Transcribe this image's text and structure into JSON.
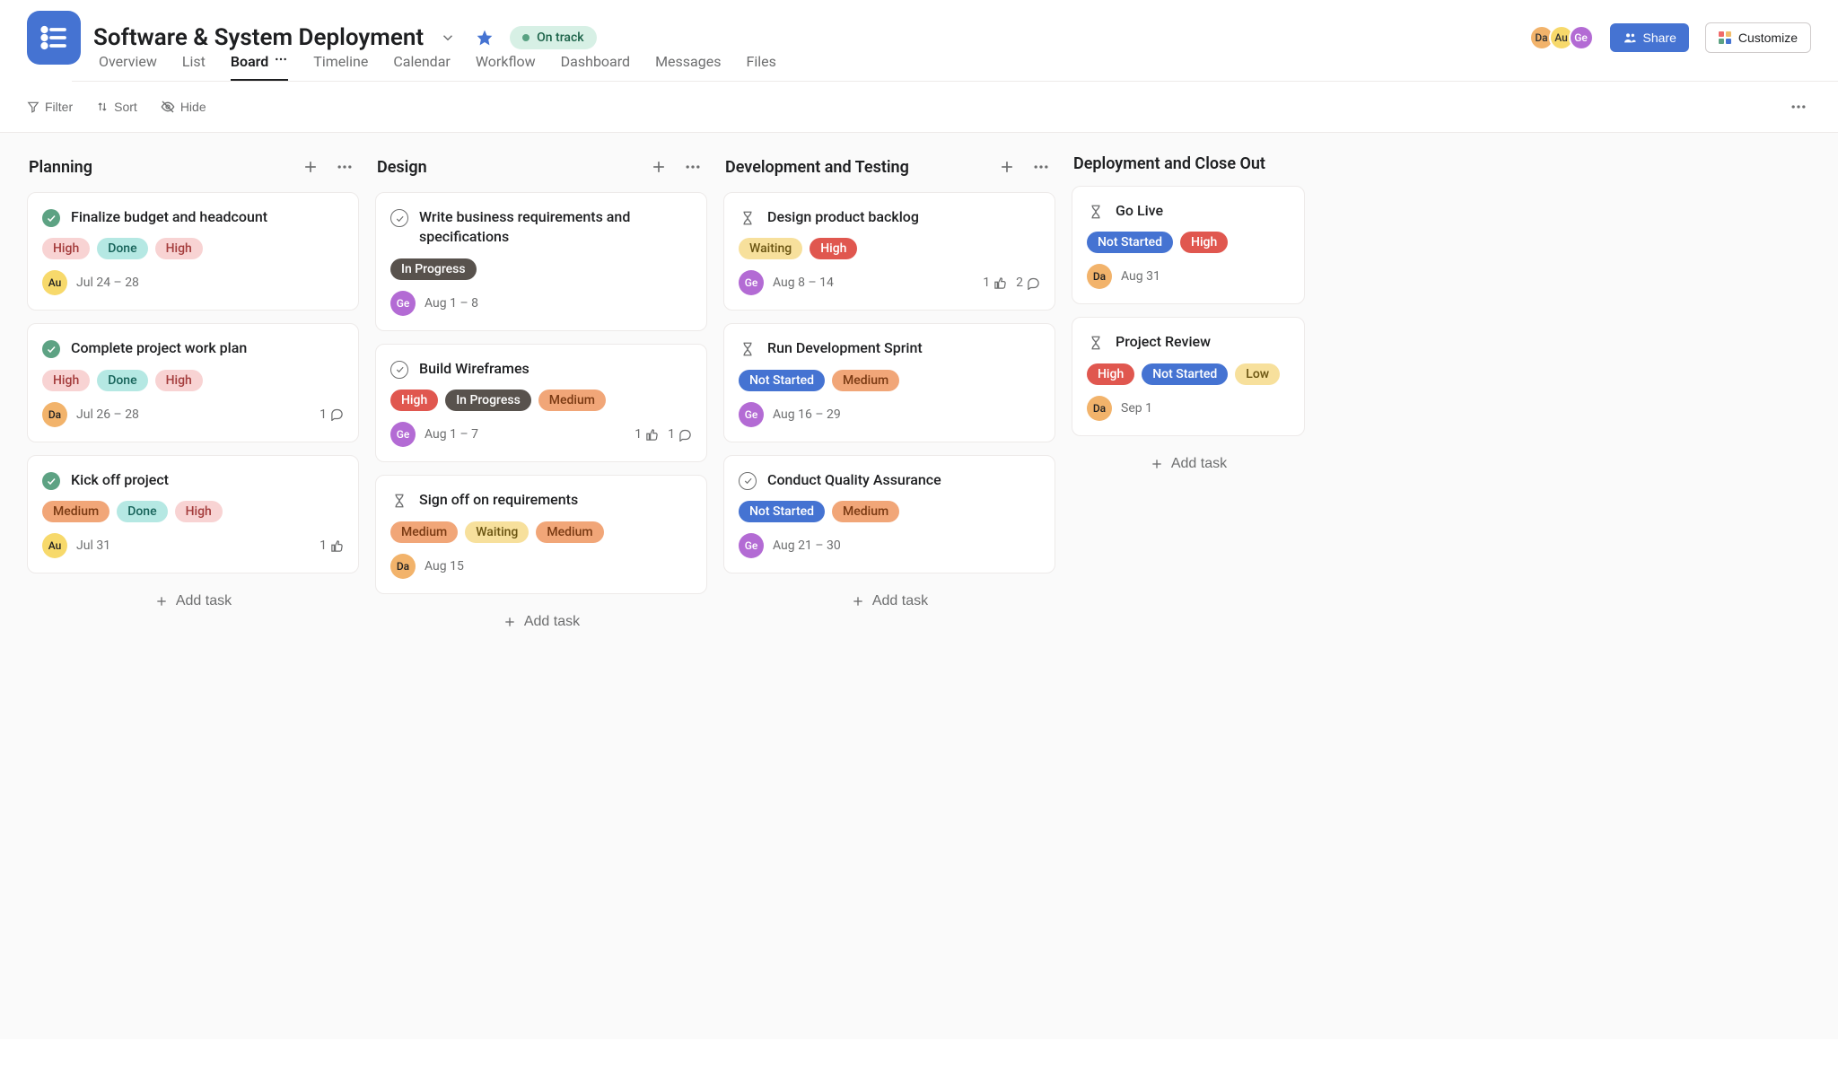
{
  "project": {
    "title": "Software & System Deployment",
    "status": "On track"
  },
  "members": [
    {
      "initials": "Da",
      "color": "av-orange"
    },
    {
      "initials": "Au",
      "color": "av-yellow"
    },
    {
      "initials": "Ge",
      "color": "av-purple"
    }
  ],
  "actions": {
    "share": "Share",
    "customize": "Customize"
  },
  "tabs": [
    "Overview",
    "List",
    "Board",
    "Timeline",
    "Calendar",
    "Workflow",
    "Dashboard",
    "Messages",
    "Files"
  ],
  "toolbar": {
    "filter": "Filter",
    "sort": "Sort",
    "hide": "Hide"
  },
  "addTask": "Add task",
  "columns": [
    {
      "title": "Planning",
      "cards": [
        {
          "status": "done",
          "title": "Finalize budget and headcount",
          "chips": [
            {
              "text": "High",
              "cls": "chip-red"
            },
            {
              "text": "Done",
              "cls": "chip-teal"
            },
            {
              "text": "High",
              "cls": "chip-red"
            }
          ],
          "assignee": {
            "initials": "Au",
            "color": "av-yellow"
          },
          "date": "Jul 24 – 28"
        },
        {
          "status": "done",
          "title": "Complete project work plan",
          "chips": [
            {
              "text": "High",
              "cls": "chip-red"
            },
            {
              "text": "Done",
              "cls": "chip-teal"
            },
            {
              "text": "High",
              "cls": "chip-red"
            }
          ],
          "assignee": {
            "initials": "Da",
            "color": "av-orange"
          },
          "date": "Jul 26 – 28",
          "comments": 1
        },
        {
          "status": "done",
          "title": "Kick off project",
          "chips": [
            {
              "text": "Medium",
              "cls": "chip-orange"
            },
            {
              "text": "Done",
              "cls": "chip-teal"
            },
            {
              "text": "High",
              "cls": "chip-red"
            }
          ],
          "assignee": {
            "initials": "Au",
            "color": "av-yellow"
          },
          "date": "Jul 31",
          "likes": 1
        }
      ]
    },
    {
      "title": "Design",
      "cards": [
        {
          "status": "open",
          "title": "Write business requirements and specifications",
          "chips": [
            {
              "text": "In Progress",
              "cls": "chip-gray"
            }
          ],
          "assignee": {
            "initials": "Ge",
            "color": "av-purple"
          },
          "date": "Aug 1 – 8"
        },
        {
          "status": "open",
          "title": "Build Wireframes",
          "chips": [
            {
              "text": "High",
              "cls": "chip-red-strong"
            },
            {
              "text": "In Progress",
              "cls": "chip-gray"
            },
            {
              "text": "Medium",
              "cls": "chip-orange"
            }
          ],
          "assignee": {
            "initials": "Ge",
            "color": "av-purple"
          },
          "date": "Aug 1 – 7",
          "likes": 1,
          "comments": 1
        },
        {
          "status": "hourglass",
          "title": "Sign off on requirements",
          "chips": [
            {
              "text": "Medium",
              "cls": "chip-orange"
            },
            {
              "text": "Waiting",
              "cls": "chip-yellow"
            },
            {
              "text": "Medium",
              "cls": "chip-orange"
            }
          ],
          "assignee": {
            "initials": "Da",
            "color": "av-orange"
          },
          "date": "Aug 15"
        }
      ]
    },
    {
      "title": "Development and Testing",
      "cards": [
        {
          "status": "hourglass",
          "title": "Design product backlog",
          "chips": [
            {
              "text": "Waiting",
              "cls": "chip-yellow"
            },
            {
              "text": "High",
              "cls": "chip-red-strong"
            }
          ],
          "assignee": {
            "initials": "Ge",
            "color": "av-purple"
          },
          "date": "Aug 8 – 14",
          "likes": 1,
          "comments": 2
        },
        {
          "status": "hourglass",
          "title": "Run Development Sprint",
          "chips": [
            {
              "text": "Not Started",
              "cls": "chip-blue"
            },
            {
              "text": "Medium",
              "cls": "chip-orange"
            }
          ],
          "assignee": {
            "initials": "Ge",
            "color": "av-purple"
          },
          "date": "Aug 16 – 29"
        },
        {
          "status": "open",
          "title": "Conduct Quality Assurance",
          "chips": [
            {
              "text": "Not Started",
              "cls": "chip-blue"
            },
            {
              "text": "Medium",
              "cls": "chip-orange"
            }
          ],
          "assignee": {
            "initials": "Ge",
            "color": "av-purple"
          },
          "date": "Aug 21 – 30"
        }
      ]
    },
    {
      "title": "Deployment and Close Out",
      "narrow": true,
      "noHeaderActions": true,
      "cards": [
        {
          "status": "hourglass",
          "title": "Go Live",
          "chips": [
            {
              "text": "Not Started",
              "cls": "chip-blue"
            },
            {
              "text": "High",
              "cls": "chip-red-strong"
            }
          ],
          "assignee": {
            "initials": "Da",
            "color": "av-orange"
          },
          "date": "Aug 31"
        },
        {
          "status": "hourglass",
          "title": "Project Review",
          "chips": [
            {
              "text": "High",
              "cls": "chip-red-strong"
            },
            {
              "text": "Not Started",
              "cls": "chip-blue"
            },
            {
              "text": "Low",
              "cls": "chip-yellow"
            }
          ],
          "assignee": {
            "initials": "Da",
            "color": "av-orange"
          },
          "date": "Sep 1"
        }
      ]
    }
  ]
}
